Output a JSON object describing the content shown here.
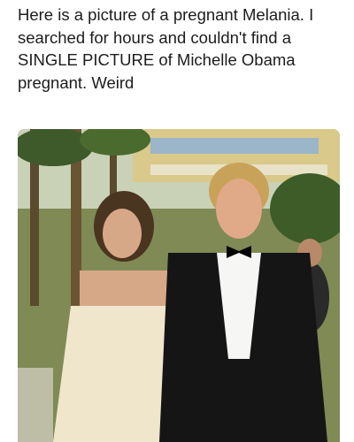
{
  "post": {
    "caption": "Here is a picture of a pregnant Melania. I searched for hours and couldn't find a SINGLE PICTURE of Michelle Obama pregnant. Weird"
  },
  "photo": {
    "kind": "photograph"
  },
  "colors": {
    "background": "#ffffff",
    "text": "#1c1c1c"
  }
}
